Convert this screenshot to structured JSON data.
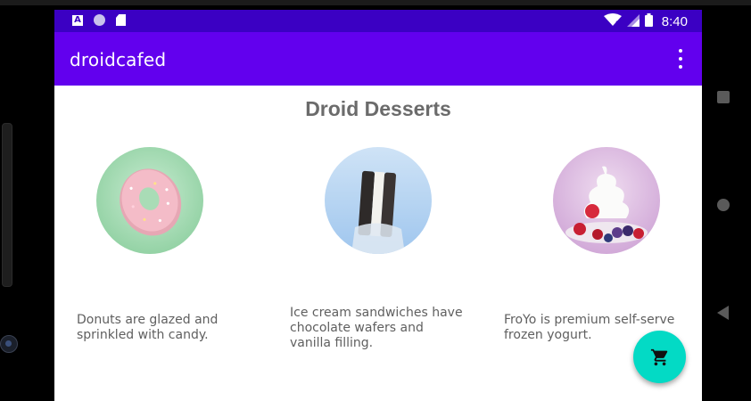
{
  "status_bar": {
    "time": "8:40",
    "notification_a": "A",
    "icons": [
      "a-notification-icon",
      "circle-notification-icon",
      "sd-card-icon",
      "wifi-icon",
      "signal-icon",
      "battery-icon"
    ]
  },
  "app_bar": {
    "title": "droidcafed",
    "menu_icon": "more-vert-icon"
  },
  "main": {
    "heading": "Droid Desserts",
    "desserts": [
      {
        "name": "donut",
        "image_icon": "donut-image",
        "description": "Donuts are glazed and sprinkled with candy."
      },
      {
        "name": "ice-cream-sandwich",
        "image_icon": "ice-cream-sandwich-image",
        "description": "Ice cream sandwiches have chocolate wafers and vanilla filling."
      },
      {
        "name": "froyo",
        "image_icon": "froyo-image",
        "description": "FroYo is premium self-serve frozen yogurt."
      }
    ]
  },
  "fab": {
    "icon": "shopping-cart-icon"
  },
  "nav": {
    "buttons": [
      "recents-square-icon",
      "home-circle-icon",
      "back-triangle-icon"
    ]
  },
  "colors": {
    "status_bar": "#3b00c3",
    "app_bar": "#6200ee",
    "fab": "#03dac5",
    "heading": "#6b6b6b",
    "text": "#5f5f5f"
  }
}
